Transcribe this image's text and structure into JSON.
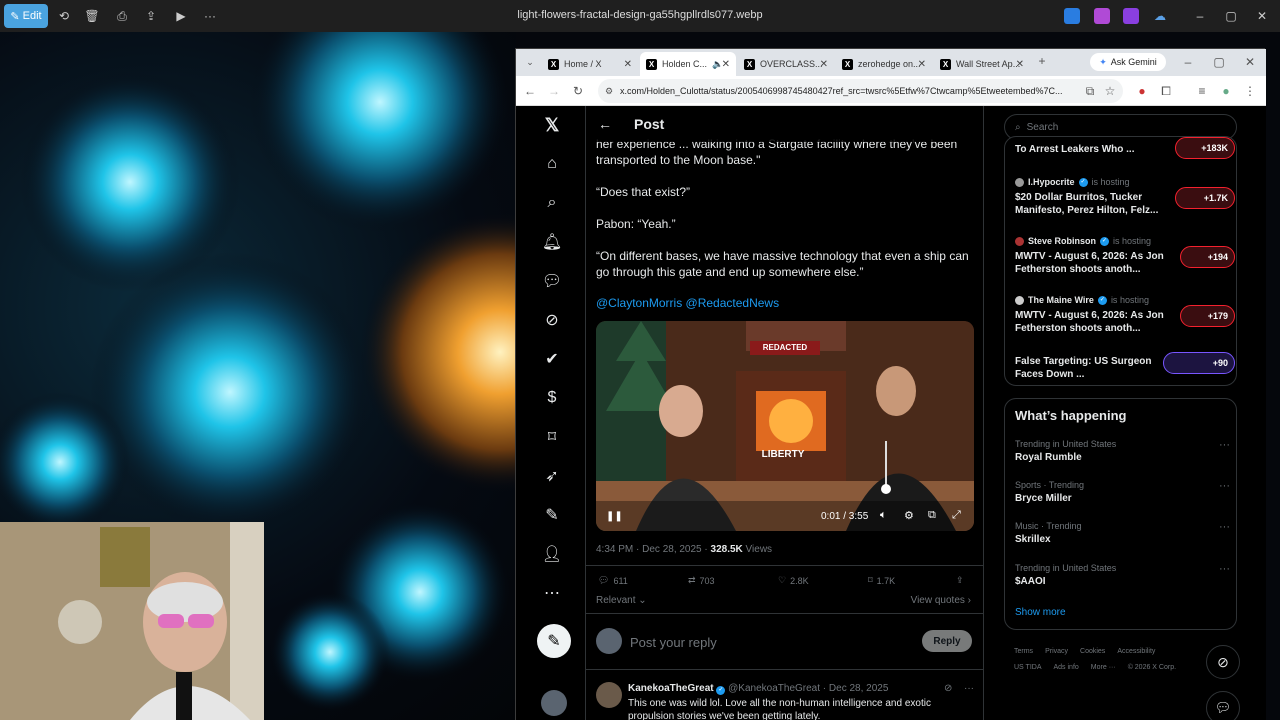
{
  "viewer": {
    "edit_label": "Edit",
    "filename": "light-flowers-fractal-design-ga55hgpllrdls077.webp"
  },
  "browser": {
    "tabs": [
      {
        "label": "Home / X"
      },
      {
        "label": "Holden C..."
      },
      {
        "label": "OVERCLASS..."
      },
      {
        "label": "zerohedge on..."
      },
      {
        "label": "Wall Street Ap..."
      }
    ],
    "ask_gemini": "Ask Gemini",
    "url": "x.com/Holden_Culotta/status/2005406998745480427ref_src=twsrc%5Etfw%7Ctwcamp%5Etweetembed%7C..."
  },
  "post": {
    "header_title": "Post",
    "para1": "her experience ... walking into a Stargate facility where they've been transported to the Moon base.\"",
    "para2": "“Does that exist?”",
    "para3": "Pabon: “Yeah.”",
    "para4": "“On different bases, we have massive technology that even a ship can go through this gate and end up somewhere else.”",
    "mentions": "@ClaytonMorris @RedactedNews",
    "video_time": "0:01 / 3:55",
    "video_banner": "REDACTED",
    "video_desk_text": "LIBERTY",
    "timestamp": "4:34 PM · Dec 28, 2025 · ",
    "views_count": "328.5K",
    "views_label": " Views",
    "replies": "611",
    "reposts": "703",
    "likes": "2.8K",
    "bookmarks": "1.7K",
    "relevancy": "Relevant",
    "view_quotes": "View quotes",
    "reply_placeholder": "Post your reply",
    "reply_button": "Reply"
  },
  "reply": {
    "name": "KanekoaTheGreat",
    "handle": "@KanekoaTheGreat · Dec 28, 2025",
    "text": "This one was wild lol. Love all the non-human intelligence and exotic propulsion stories we've been getting lately."
  },
  "search": {
    "placeholder": "Search"
  },
  "spaces": [
    {
      "host": "",
      "status": "",
      "title": "To Arrest Leakers Who ...",
      "count": "+183K",
      "color": "#f4212e"
    },
    {
      "host": "I.Hypocrite",
      "status": "is hosting",
      "title": "$20 Dollar Burritos, Tucker Manifesto, Perez Hilton, Felz...",
      "count": "+1.7K",
      "color": "#f4212e"
    },
    {
      "host": "Steve Robinson",
      "status": "is hosting",
      "title": "MWTV - August 6, 2026: As Jon Fetherston shoots anoth...",
      "count": "+194",
      "color": "#f4212e"
    },
    {
      "host": "The Maine Wire",
      "status": "is hosting",
      "title": "MWTV - August 6, 2026: As Jon Fetherston shoots anoth...",
      "count": "+179",
      "color": "#f4212e"
    },
    {
      "host": "",
      "status": "",
      "title": "False Targeting: US Surgeon Faces Down ...",
      "count": "+90",
      "color": "#7856ff"
    }
  ],
  "happening": {
    "title": "What’s happening",
    "items": [
      {
        "category": "Trending in United States",
        "name": "Royal Rumble"
      },
      {
        "category": "Sports · Trending",
        "name": "Bryce Miller"
      },
      {
        "category": "Music · Trending",
        "name": "Skrillex"
      },
      {
        "category": "Trending in United States",
        "name": "$AAOI"
      }
    ],
    "show_more": "Show more"
  },
  "footer": {
    "links": [
      "Terms",
      "Privacy",
      "Cookies",
      "Accessibility",
      "US TIDA",
      "Ads info",
      "More ···",
      "© 2026 X Corp."
    ]
  },
  "colors": {
    "accent": "#1d9bf0",
    "background": "#000000",
    "border": "#2f3336"
  }
}
